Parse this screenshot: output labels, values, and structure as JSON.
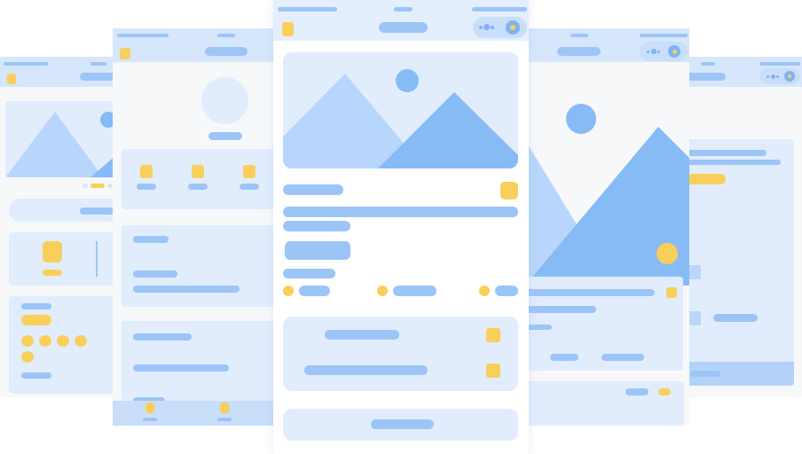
{
  "canvas": {
    "background": "#ffffff"
  },
  "palette": {
    "screen_bg": "#f7f8fa",
    "topbar": "#d6e6fb",
    "panel": "#e1edfd",
    "placeholder_bar": "#9cc5f7",
    "placeholder_bar_light": "#bad7fa",
    "accent_yellow": "#f8cf5b",
    "mountain_light": "#b8d6fb",
    "mountain_dark": "#86bbf6",
    "sun": "#86bbf6"
  },
  "screens": [
    {
      "id": "far-left",
      "kind": "wireframe-mobile-screen"
    },
    {
      "id": "left",
      "kind": "wireframe-profile-screen"
    },
    {
      "id": "center",
      "kind": "wireframe-detail-screen"
    },
    {
      "id": "right",
      "kind": "wireframe-media-screen"
    },
    {
      "id": "far-right",
      "kind": "wireframe-list-screen"
    }
  ],
  "icons": {
    "image_placeholder": "image-placeholder-icon",
    "toggle": "toggle-icon",
    "menu_square": "yellow-square-icon"
  }
}
